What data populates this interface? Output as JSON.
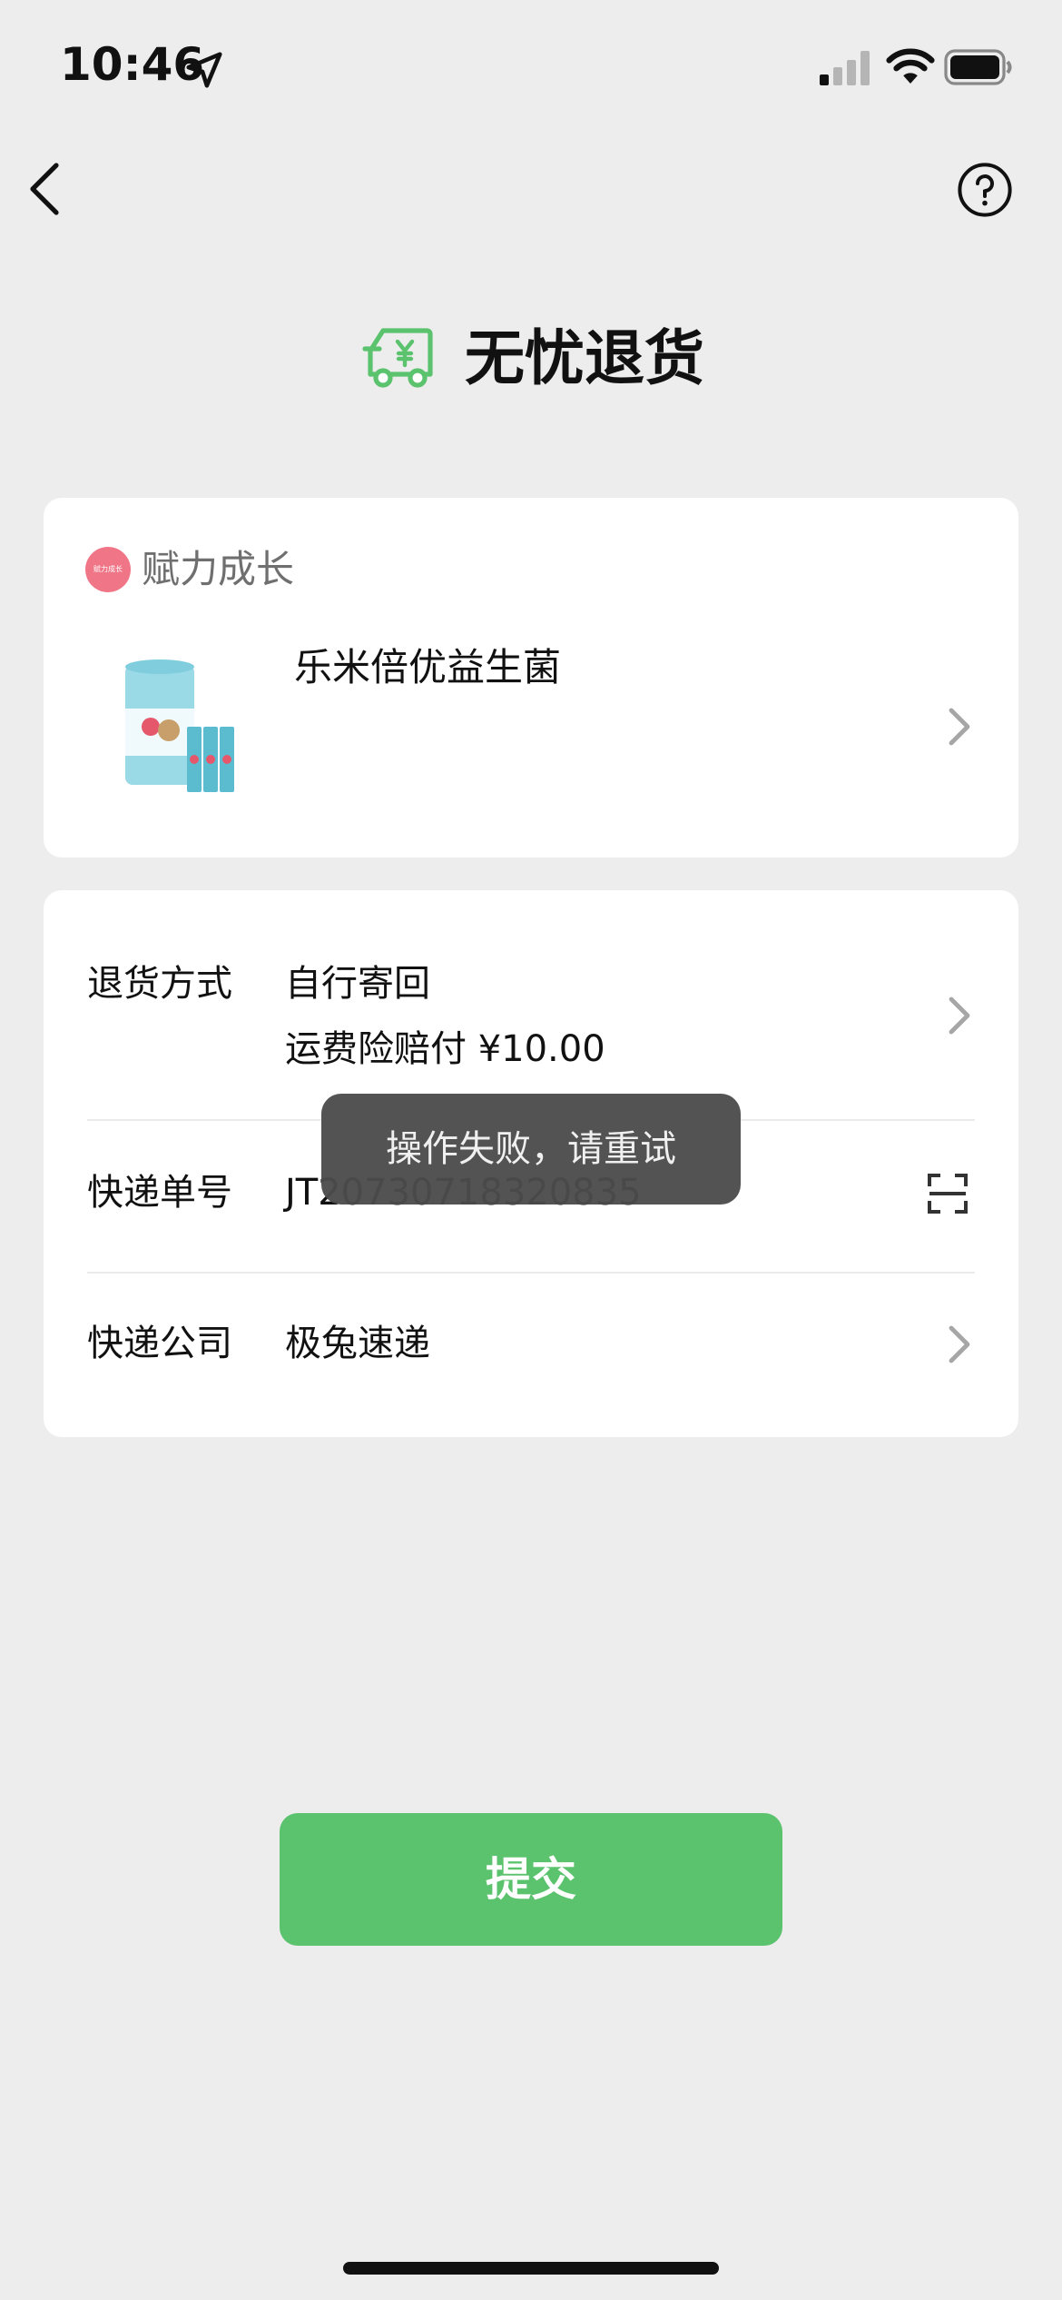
{
  "status_bar": {
    "time": "10:46"
  },
  "header": {
    "title": "无忧退货",
    "icon": "return-truck-yen-icon"
  },
  "shop": {
    "name": "赋力成长",
    "logo_text": "赋力成长"
  },
  "product": {
    "name": "乐米倍优益生菌"
  },
  "return_method": {
    "label": "退货方式",
    "value": "自行寄回",
    "note": "运费险赔付 ¥10.00"
  },
  "tracking": {
    "label": "快递单号",
    "value": "JT20730718320835"
  },
  "courier": {
    "label": "快递公司",
    "value": "极兔速递"
  },
  "toast": {
    "text": "操作失败，请重试"
  },
  "submit": {
    "label": "提交"
  },
  "colors": {
    "accent": "#5bc36e",
    "background": "#ededed",
    "toast_bg": "#4c4c4c"
  }
}
